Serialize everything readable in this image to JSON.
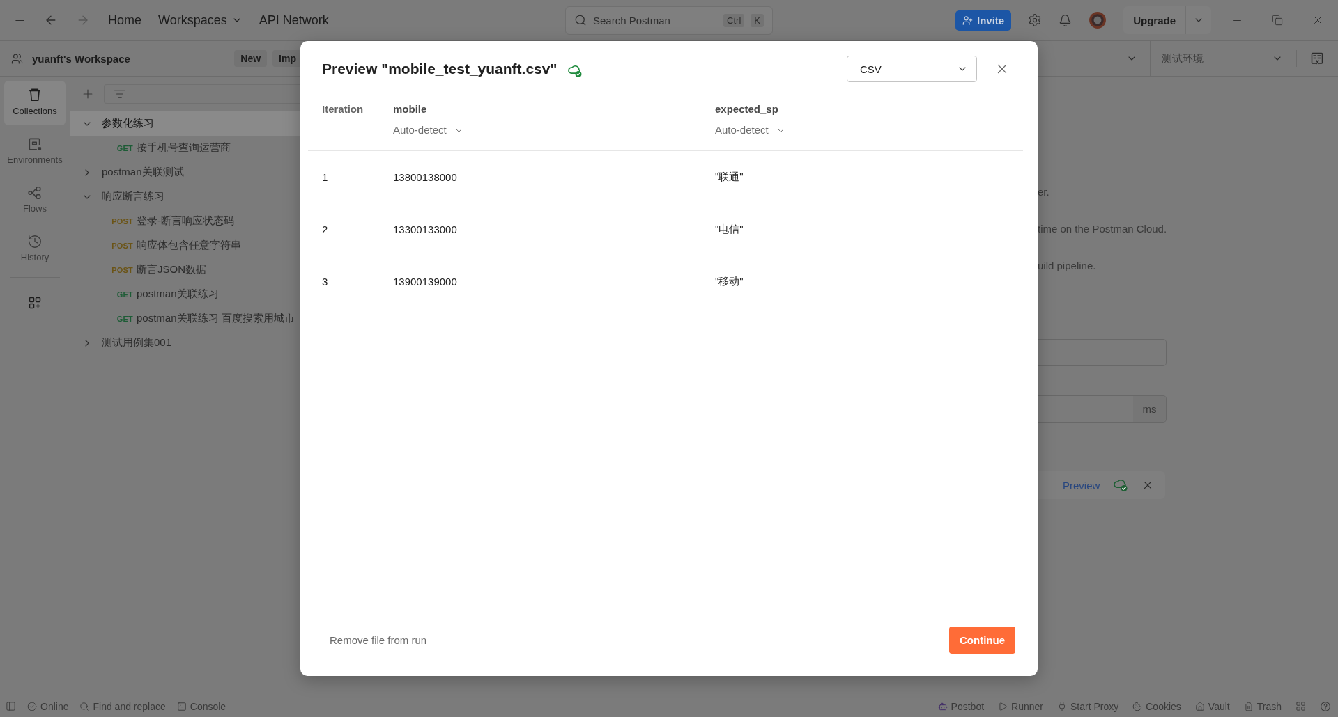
{
  "top_bar": {
    "back_disabled": false,
    "forward_disabled": true,
    "links": [
      {
        "label": "Home",
        "kind": "link"
      },
      {
        "label": "Workspaces",
        "kind": "menu"
      },
      {
        "label": "API Network",
        "kind": "link"
      }
    ],
    "search": {
      "placeholder": "Search Postman",
      "shortcut": [
        "Ctrl",
        "K"
      ]
    },
    "invite": "Invite",
    "upgrade": "Upgrade"
  },
  "sidebar": {
    "workspace": "yuanft's Workspace",
    "buttons": [
      "New",
      "Imp"
    ],
    "nav": [
      {
        "label": "Collections",
        "selected": true
      },
      {
        "label": "Environments",
        "selected": false
      },
      {
        "label": "Flows",
        "selected": false
      },
      {
        "label": "History",
        "selected": false
      }
    ],
    "tree": [
      {
        "label": "参数化练习",
        "expanded": true,
        "selected": true,
        "children": [
          {
            "method": "GET",
            "color": "#1d5c36",
            "label": "按手机号查询运营商",
            "selected": false
          }
        ]
      },
      {
        "label": "postman关联测试",
        "expanded": false,
        "selected": false
      },
      {
        "label": "响应断言练习",
        "expanded": true,
        "selected": false,
        "children": [
          {
            "method": "POST",
            "color": "#6b5416",
            "label": "登录-断言响应状态码",
            "selected": false
          },
          {
            "method": "POST",
            "color": "#6b5416",
            "label": "响应体包含任意字符串",
            "selected": false
          },
          {
            "method": "POST",
            "color": "#6b5416",
            "label": "断言JSON数据",
            "selected": false
          },
          {
            "method": "GET",
            "color": "#1d5c36",
            "label": "postman关联练习",
            "selected": false
          },
          {
            "method": "GET",
            "color": "#1d5c36",
            "label": "postman关联练习 百度搜索用城市",
            "selected": false
          }
        ]
      },
      {
        "label": "测试用例集001",
        "expanded": false,
        "selected": false
      }
    ]
  },
  "main": {
    "environment": "测试环境",
    "description": [
      "er.",
      "time on the Postman Cloud.",
      "uild pipeline."
    ],
    "delay_unit": "ms",
    "data_file": {
      "preview": "Preview"
    }
  },
  "modal": {
    "title": "Preview \"mobile_test_yuanft.csv\"",
    "file_type": "CSV",
    "columns": [
      {
        "name": "Iteration"
      },
      {
        "name": "mobile",
        "type": "Auto-detect"
      },
      {
        "name": "expected_sp",
        "type": "Auto-detect"
      }
    ],
    "rows": [
      [
        "1",
        "13800138000",
        "\"联通\""
      ],
      [
        "2",
        "13300133000",
        "\"电信\""
      ],
      [
        "3",
        "13900139000",
        "\"移动\""
      ]
    ],
    "remove": "Remove file from run",
    "continue": "Continue"
  },
  "status_bar": {
    "left": [
      "Online",
      "Find and replace",
      "Console"
    ],
    "right": [
      "Postbot",
      "Runner",
      "Start Proxy",
      "Cookies",
      "Vault",
      "Trash"
    ]
  }
}
